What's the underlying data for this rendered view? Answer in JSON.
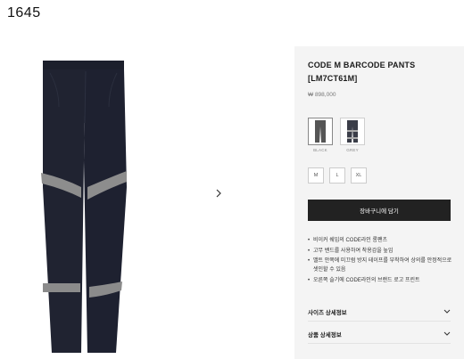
{
  "page_number": "1645",
  "product": {
    "title_line1": "CODE M BARCODE PANTS",
    "title_line2": "[LM7CT61M]",
    "price": "₩ 898,000"
  },
  "colors": [
    {
      "label": "BLACK",
      "selected": true
    },
    {
      "label": "GREY",
      "selected": false
    }
  ],
  "sizes": [
    "M",
    "L",
    "XL"
  ],
  "cart_button": "장바구니에 담기",
  "features": [
    "비이커 쉐입의 CODE라인 롱팬츠",
    "고무 밴드를 사용하여 착용감을 높임",
    "밸트 안쪽에 미끄럼 방지 테이프를 부착하여 상의를 안정적으로 셋인할 수 있음",
    "오른쪽 슬기에 CODE라인의 브랜드 로고 프린트"
  ],
  "accordions": {
    "size_info": "사이즈 상세정보",
    "product_info": "상품 상세정보"
  },
  "icons": {
    "next": "chevron-right-icon",
    "expand": "chevron-down-icon"
  },
  "palette": {
    "pants": "#1f2230",
    "stripe": "#8a8a8a",
    "panel_bg": "#f4f4f4",
    "button_bg": "#222222"
  }
}
